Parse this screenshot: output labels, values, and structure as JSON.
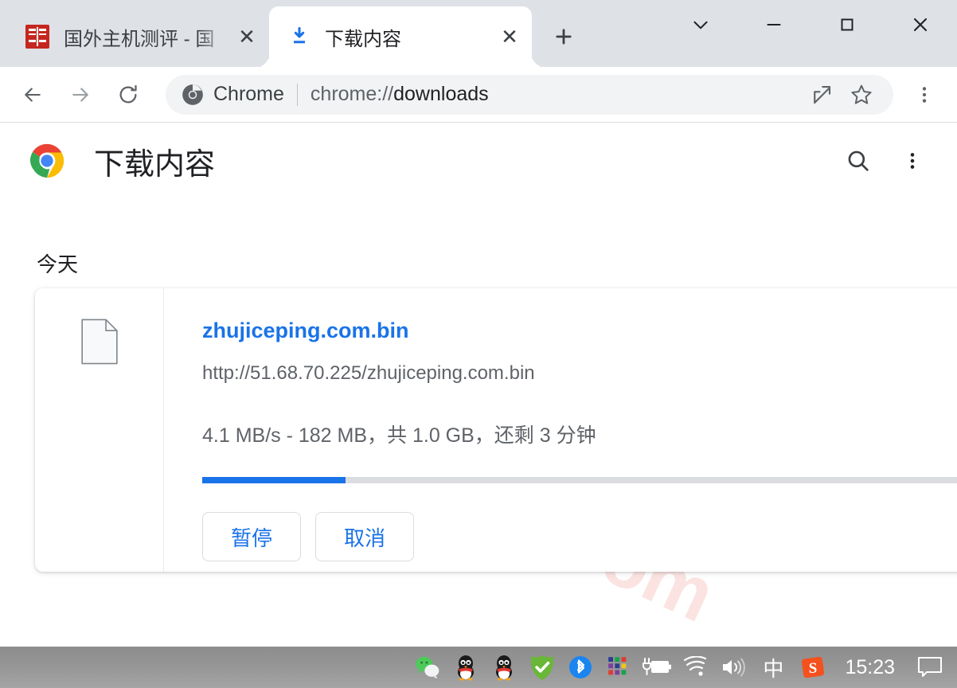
{
  "window": {
    "controls": [
      {
        "name": "tab-search",
        "glyph": "chevron-down"
      },
      {
        "name": "minimize",
        "glyph": "minimize"
      },
      {
        "name": "maximize",
        "glyph": "maximize"
      },
      {
        "name": "close",
        "glyph": "close"
      }
    ]
  },
  "tabs": [
    {
      "title": "国外主机测评 - 国",
      "favicon": "red-site-favicon",
      "active": false,
      "close_label": "✕"
    },
    {
      "title": "下载内容",
      "favicon": "download-icon",
      "active": true,
      "close_label": "✕"
    }
  ],
  "new_tab_label": "+",
  "toolbar": {
    "back_label": "back-icon",
    "forward_label": "forward-icon",
    "reload_label": "reload-icon",
    "omnibox": {
      "brand": "Chrome",
      "url_prefix": "chrome://",
      "url_rest": "downloads",
      "full_url": "chrome://downloads",
      "share_icon": "share-icon",
      "bookmark_icon": "star-icon"
    },
    "menu_icon": "three-dots-icon"
  },
  "downloads_page": {
    "title": "下载内容",
    "logo": "chrome-logo-icon",
    "search_icon": "search-icon",
    "menu_icon": "three-dots-icon",
    "watermark": "zhujiceping.com",
    "date_group": "今天",
    "item": {
      "file_icon": "generic-file-icon",
      "file_name": "zhujiceping.com.bin",
      "source_url": "http://51.68.70.225/zhujiceping.com.bin",
      "status": "4.1 MB/s - 182 MB，共 1.0 GB，还剩 3 分钟",
      "speed": "4.1 MB/s",
      "downloaded": "182 MB",
      "total_size": "1.0 GB",
      "time_remaining": "3 分钟",
      "progress_percent": 18,
      "progress_color": "#1a73e8",
      "buttons": [
        {
          "label": "暂停",
          "name": "pause-button"
        },
        {
          "label": "取消",
          "name": "cancel-button"
        }
      ]
    }
  },
  "taskbar": {
    "tray_icons": [
      {
        "name": "wechat-icon"
      },
      {
        "name": "qq-icon"
      },
      {
        "name": "qq-secondary-icon"
      },
      {
        "name": "360-security-icon"
      },
      {
        "name": "bluetooth-icon"
      },
      {
        "name": "color-grid-icon"
      },
      {
        "name": "battery-charging-icon"
      },
      {
        "name": "wifi-icon"
      },
      {
        "name": "volume-icon"
      }
    ],
    "ime_label": "中",
    "sogou_label": "S",
    "clock": "15:23",
    "action_center_icon": "notifications-icon"
  }
}
